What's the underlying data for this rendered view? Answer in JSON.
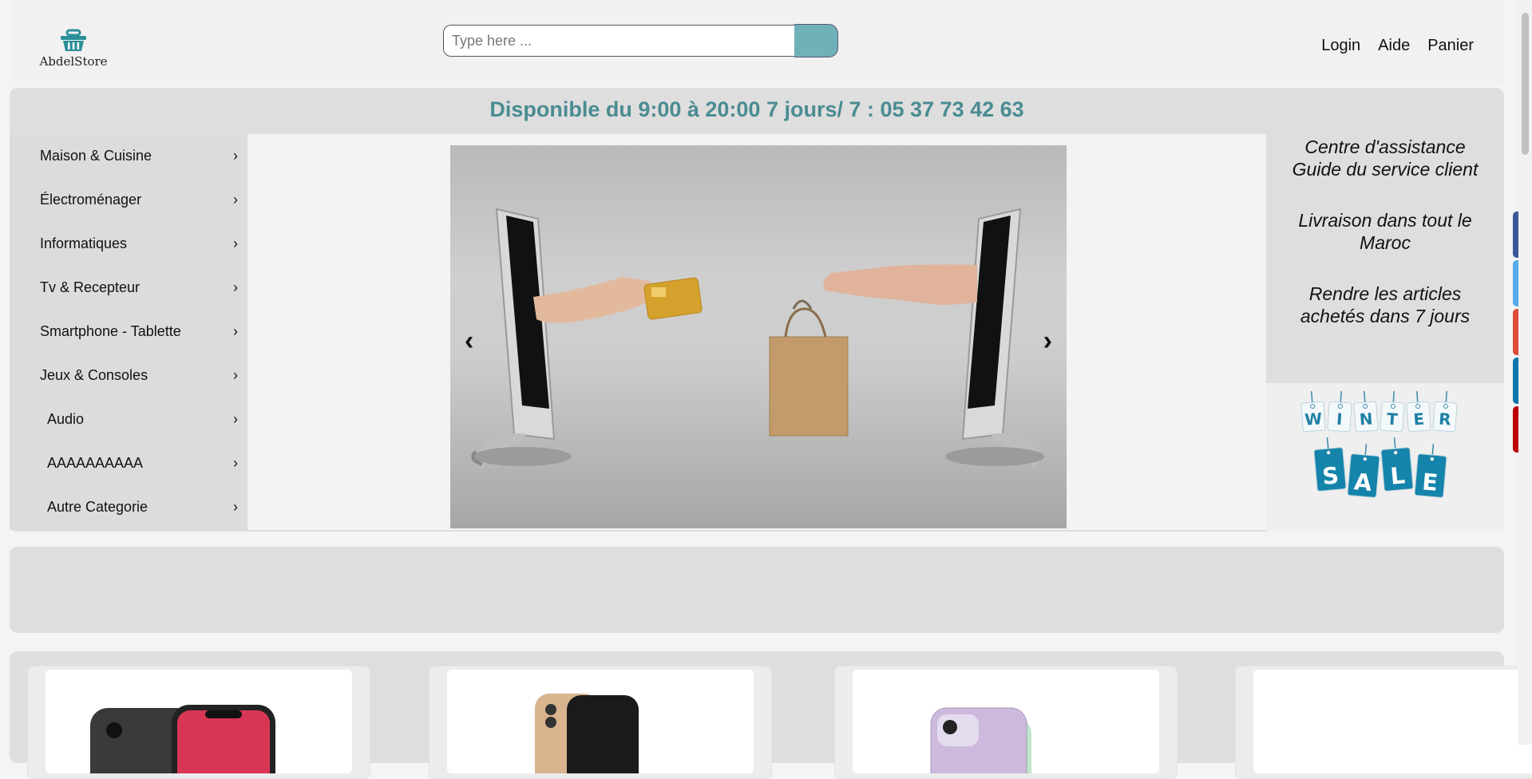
{
  "brand": {
    "name": "AbdelStore"
  },
  "search": {
    "placeholder": "Type here ..."
  },
  "nav": {
    "login": "Login",
    "help": "Aide",
    "cart": "Panier"
  },
  "availability": "Disponible du 9:00 à 20:00 7 jours/ 7 : 05 37 73 42 63",
  "sidebar": {
    "items": [
      {
        "label": "Maison & Cuisine"
      },
      {
        "label": "Électroménager"
      },
      {
        "label": "Informatiques"
      },
      {
        "label": "Tv & Recepteur"
      },
      {
        "label": "Smartphone - Tablette"
      },
      {
        "label": "Jeux & Consoles"
      },
      {
        "label": "Audio"
      },
      {
        "label": "AAAAAAAAAA"
      },
      {
        "label": "Autre Categorie"
      }
    ]
  },
  "carousel": {
    "prev": "‹",
    "next": "›"
  },
  "info": {
    "line1": "Centre d'assistance",
    "line2": "Guide du service client",
    "line3": "Livraison dans tout le Maroc",
    "line4": "Rendre les articles achetés dans 7 jours"
  },
  "sale_banner": {
    "top": [
      "W",
      "I",
      "N",
      "T",
      "E",
      "R"
    ],
    "bottom": [
      "S",
      "A",
      "L",
      "E"
    ]
  },
  "social_colors": [
    "#3b5998",
    "#55acee",
    "#dd4b39",
    "#0e76a8",
    "#b00"
  ],
  "accent": "#6fb1b8"
}
